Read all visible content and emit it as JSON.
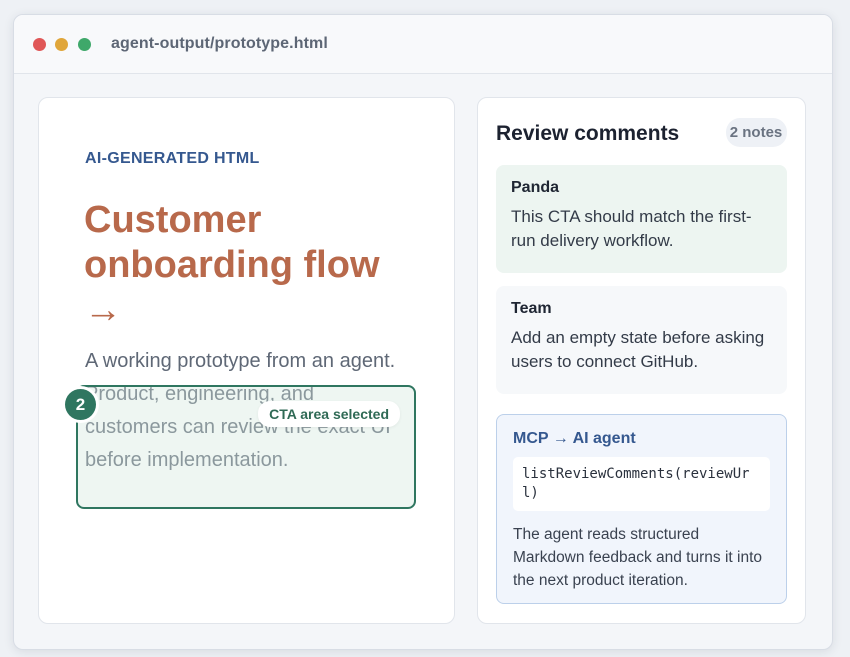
{
  "window": {
    "title": "agent-output/prototype.html"
  },
  "prototype": {
    "eyebrow": "AI-GENERATED HTML",
    "headline": "Customer onboarding flow",
    "headline_arrow": "→",
    "description": "A working prototype from an agent. Product, engineering, and customers can review the exact UI before implementation.",
    "selection_label": "CTA area selected",
    "selection_badge": "2"
  },
  "review": {
    "title": "Review comments",
    "count_label": "2 notes",
    "comments": [
      {
        "author": "Panda",
        "text": "This CTA should match the first-run delivery workflow."
      },
      {
        "author": "Team",
        "text": "Add an empty state before asking users to connect GitHub."
      }
    ],
    "mcp": {
      "title": "MCP → AI agent",
      "code": "listReviewComments(reviewUrl)",
      "text": "The agent reads structured Markdown feedback and turns it into the next product iteration."
    }
  },
  "colors": {
    "accent_green": "#2f7660",
    "heading_orange": "#b8694b",
    "label_blue": "#35588f"
  }
}
